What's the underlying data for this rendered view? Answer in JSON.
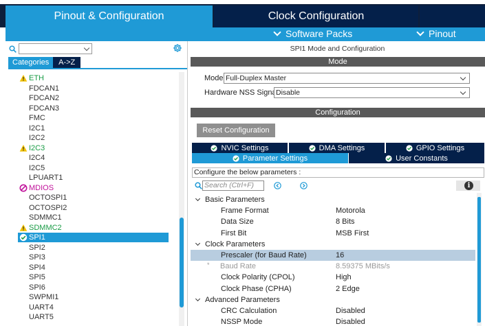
{
  "top_tabs": {
    "pinout": "Pinout & Configuration",
    "clock": "Clock Configuration"
  },
  "subbar": {
    "software_packs": "Software Packs",
    "pinout": "Pinout"
  },
  "left_panel": {
    "search_value": "",
    "category_tabs": [
      "Categories",
      "A->Z"
    ],
    "items": [
      {
        "label": "ETH",
        "status": "warning"
      },
      {
        "label": "FDCAN1",
        "status": "none"
      },
      {
        "label": "FDCAN2",
        "status": "none"
      },
      {
        "label": "FDCAN3",
        "status": "none"
      },
      {
        "label": "FMC",
        "status": "none"
      },
      {
        "label": "I2C1",
        "status": "none"
      },
      {
        "label": "I2C2",
        "status": "none"
      },
      {
        "label": "I2C3",
        "status": "warning"
      },
      {
        "label": "I2C4",
        "status": "none"
      },
      {
        "label": "I2C5",
        "status": "none"
      },
      {
        "label": "LPUART1",
        "status": "none"
      },
      {
        "label": "MDIOS",
        "status": "error"
      },
      {
        "label": "OCTOSPI1",
        "status": "none"
      },
      {
        "label": "OCTOSPI2",
        "status": "none"
      },
      {
        "label": "SDMMC1",
        "status": "none"
      },
      {
        "label": "SDMMC2",
        "status": "warning"
      },
      {
        "label": "SPI1",
        "status": "ok"
      },
      {
        "label": "SPI2",
        "status": "none"
      },
      {
        "label": "SPI3",
        "status": "none"
      },
      {
        "label": "SPI4",
        "status": "none"
      },
      {
        "label": "SPI5",
        "status": "none"
      },
      {
        "label": "SPI6",
        "status": "none"
      },
      {
        "label": "SWPMI1",
        "status": "none"
      },
      {
        "label": "UART4",
        "status": "none"
      },
      {
        "label": "UART5",
        "status": "none"
      }
    ]
  },
  "right_panel": {
    "title": "SPI1 Mode and Configuration",
    "mode_band": "Mode",
    "mode_label": "Mode",
    "mode_value": "Full-Duplex Master",
    "nss_label": "Hardware NSS Signal",
    "nss_value": "Disable",
    "config_band": "Configuration",
    "reset_button": "Reset Configuration",
    "tabs_row1": [
      "NVIC Settings",
      "DMA Settings",
      "GPIO Settings"
    ],
    "tabs_row2": [
      "Parameter Settings",
      "User Constants"
    ],
    "configure_text": "Configure the below parameters :",
    "search_placeholder": "Search (Ctrl+F)",
    "groups": [
      {
        "name": "Basic Parameters",
        "params": [
          {
            "key": "Frame Format",
            "value": "Motorola"
          },
          {
            "key": "Data Size",
            "value": "8 Bits"
          },
          {
            "key": "First Bit",
            "value": "MSB First"
          }
        ]
      },
      {
        "name": "Clock Parameters",
        "params": [
          {
            "key": "Prescaler (for Baud Rate)",
            "value": "16"
          },
          {
            "key": "Baud Rate",
            "value": "8.59375 MBits/s"
          },
          {
            "key": "Clock Polarity (CPOL)",
            "value": "High"
          },
          {
            "key": "Clock Phase (CPHA)",
            "value": "2 Edge"
          }
        ]
      },
      {
        "name": "Advanced Parameters",
        "params": [
          {
            "key": "CRC Calculation",
            "value": "Disabled"
          },
          {
            "key": "NSSP Mode",
            "value": "Disabled"
          }
        ]
      }
    ]
  },
  "colors": {
    "accent_blue": "#1f9ad6",
    "navy": "#04204a",
    "band_gray": "#595959",
    "highlight_row": "#b8cde0",
    "warning": "#f2c200",
    "error": "#c0109a",
    "ok_green": "#1a9c46"
  }
}
